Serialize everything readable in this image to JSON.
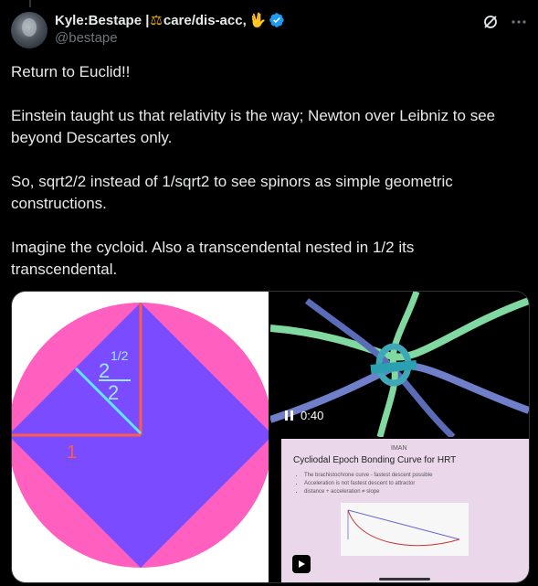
{
  "author": {
    "display_name": "Kyle:Bestape | ",
    "display_name_suffix": "care/dis-acc,",
    "scales_emoji": "⚖",
    "hand_emoji": "🖖",
    "handle": "@bestape",
    "verified": true,
    "verified_color": "#1d9bf0"
  },
  "actions": {
    "grok_icon": "grok-icon",
    "more_icon": "more-icon"
  },
  "tweet": {
    "paragraphs": [
      "Return to Euclid!!",
      "Einstein taught us that relativity is the way; Newton over Leibniz to see beyond Descartes only.",
      "So, sqrt2/2 instead of 1/sqrt2 to see spinors as simple geometric constructions.",
      "Imagine the cycloid. Also a transcendental nested in 1/2 its transcendental."
    ]
  },
  "media": {
    "diagram": {
      "circle_color": "#ff5fbf",
      "square_color": "#7b4cff",
      "radius_label": "1",
      "fraction_num_base": "2",
      "fraction_num_exp": "1/2",
      "fraction_den": "2"
    },
    "video": {
      "duration": "0:40",
      "pause_icon": "pause-icon"
    },
    "slide": {
      "logo_text": "IMAN",
      "title": "Cycliodal Epoch Bonding Curve for HRT",
      "bullets": [
        "The brachistochrone curve - fastest descent possible",
        "Acceleration is not fastest descent to attractor",
        "distance + acceleration ≠ slope"
      ],
      "play_icon": "play-icon"
    }
  },
  "colors": {
    "background": "#000000",
    "text_primary": "#e7e9ea",
    "text_secondary": "#71767b",
    "accent": "#1d9bf0"
  }
}
